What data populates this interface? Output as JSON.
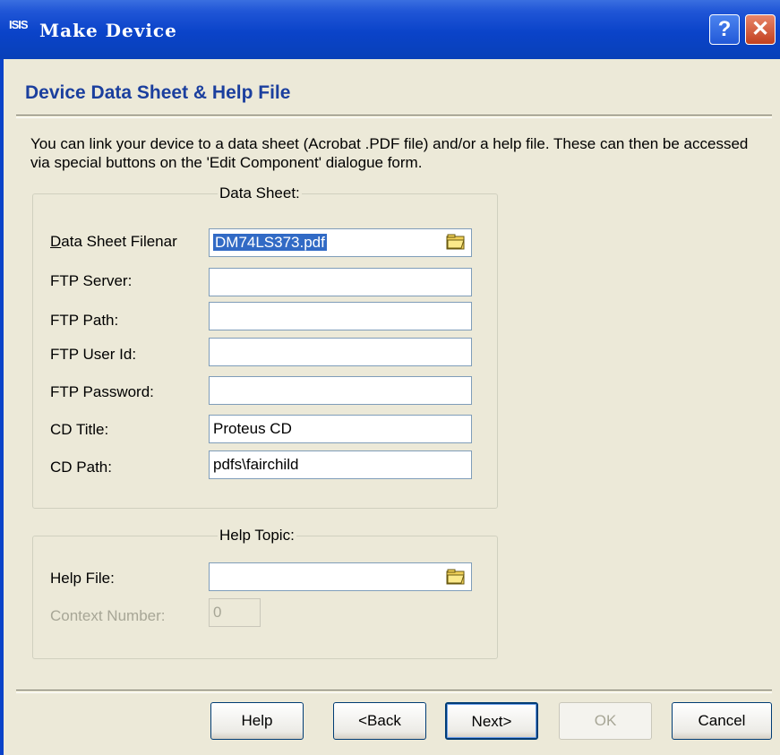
{
  "window": {
    "app_icon": "ISIS",
    "title": "Make Device",
    "help_button": "?",
    "close_button": "✕"
  },
  "page": {
    "title": "Device Data Sheet & Help File",
    "description": "You can link your device to a data sheet (Acrobat .PDF file) and/or a help file. These can then be accessed via special buttons on the 'Edit Component' dialogue form."
  },
  "data_sheet": {
    "group_title": "Data Sheet:",
    "filename_label": "Data Sheet Filenar",
    "filename_value": "DM74LS373.pdf",
    "ftp_server_label": "FTP Server:",
    "ftp_server_value": "",
    "ftp_path_label": "FTP Path:",
    "ftp_path_value": "",
    "ftp_user_label": "FTP User Id:",
    "ftp_user_value": "",
    "ftp_password_label": "FTP Password:",
    "ftp_password_value": "",
    "cd_title_label": "CD Title:",
    "cd_title_value": "Proteus CD",
    "cd_path_label": "CD Path:",
    "cd_path_value": "pdfs\\fairchild"
  },
  "help_topic": {
    "group_title": "Help Topic:",
    "help_file_label": "Help File:",
    "help_file_value": "",
    "context_label": "Context Number:",
    "context_value": "0"
  },
  "buttons": {
    "help": "Help",
    "back": "<Back",
    "next": "Next>",
    "ok": "OK",
    "cancel": "Cancel"
  },
  "icons": {
    "browse": "folder-open-icon",
    "app": "isis-app-icon"
  },
  "colors": {
    "title_bar": "#0a43c9",
    "page_title": "#1b3f9e",
    "selection": "#316ac5",
    "dialog_bg": "#ece9d8"
  }
}
